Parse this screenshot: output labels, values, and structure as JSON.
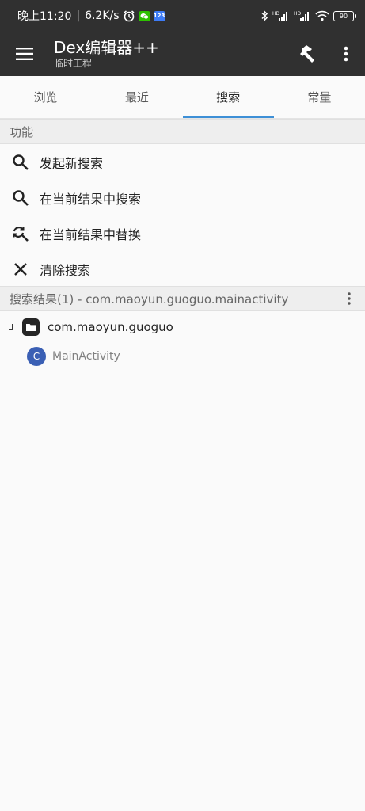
{
  "status_bar": {
    "time": "晚上11:20",
    "separator": "|",
    "speed": "6.2K/s",
    "app_badge": "123",
    "battery": "90",
    "icons": [
      "alarm-icon",
      "wechat-icon",
      "app-123-icon",
      "bluetooth-icon",
      "hd-signal-icon",
      "hd-signal-icon",
      "wifi-icon",
      "battery-icon"
    ]
  },
  "app_bar": {
    "title": "Dex编辑器++",
    "subtitle": "临时工程",
    "icons": [
      "menu-icon",
      "hammer-icon",
      "more-vert-icon"
    ]
  },
  "tabs": [
    {
      "label": "浏览",
      "active": false
    },
    {
      "label": "最近",
      "active": false
    },
    {
      "label": "搜索",
      "active": true
    },
    {
      "label": "常量",
      "active": false
    }
  ],
  "functions": {
    "header": "功能",
    "items": [
      {
        "label": "发起新搜索",
        "icon": "search-icon"
      },
      {
        "label": "在当前结果中搜索",
        "icon": "search-icon"
      },
      {
        "label": "在当前结果中替换",
        "icon": "replace-icon"
      },
      {
        "label": "清除搜索",
        "icon": "close-icon"
      }
    ]
  },
  "results": {
    "header": "搜索结果(1) - com.maoyun.guoguo.mainactivity",
    "package": "com.maoyun.guoguo",
    "class_badge": "C",
    "class_name": "MainActivity"
  },
  "colors": {
    "bar": "#303030",
    "tab_indicator": "#3d8fd6",
    "class_badge": "#3a5fb4"
  }
}
